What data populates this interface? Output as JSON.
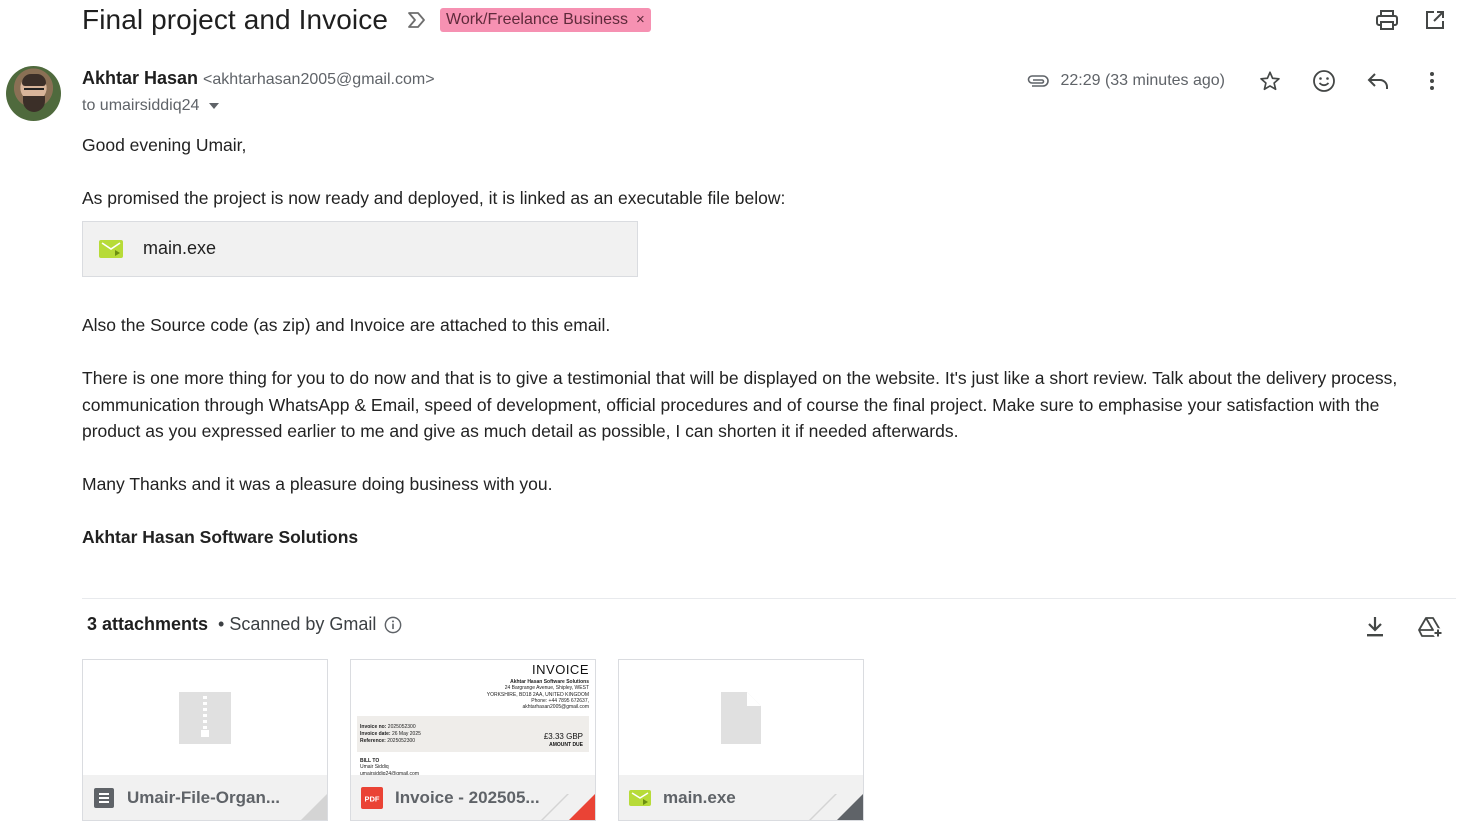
{
  "email": {
    "subject": "Final project and Invoice",
    "label": "Work/Freelance Business",
    "label_color": "#f691b2",
    "sender_name": "Akhtar Hasan",
    "sender_email": "<akhtarhasan2005@gmail.com>",
    "to_line": "to umairsiddiq24",
    "time": "22:29 (33 minutes ago)"
  },
  "icons": {
    "print": "print-icon",
    "open_new_window": "open-in-new-window-icon",
    "star": "star-icon",
    "emoji": "emoji-reaction-icon",
    "reply": "reply-icon",
    "more": "more-vert-icon",
    "attachment": "paperclip-icon",
    "download_all": "download-icon",
    "add_to_drive": "add-to-drive-icon"
  },
  "body": {
    "greeting": "Good evening Umair,",
    "p1": "As promised the project is now ready and deployed, it is linked as an executable file below:",
    "linked_file": "main.exe",
    "p2": "Also the Source code (as zip) and Invoice are attached to this email.",
    "p3": "There is one more thing for you to do now and that is to give a testimonial that will be displayed on the website. It's just like a short review. Talk about the delivery process, communication through WhatsApp & Email, speed of development, official procedures and of course the final project. Make sure to emphasise your satisfaction with the product as you expressed earlier to me and give as much detail as possible, I can shorten it if needed afterwards.",
    "p4": "Many Thanks and it was a pleasure doing business with you.",
    "signature": "Akhtar Hasan Software Solutions"
  },
  "attachments": {
    "count_label": "3 attachments",
    "scanned_label": "• Scanned by Gmail",
    "items": [
      {
        "name": "Umair-File-Organ...",
        "type": "zip"
      },
      {
        "name": "Invoice - 202505...",
        "type": "pdf"
      },
      {
        "name": "main.exe",
        "type": "exe"
      }
    ]
  },
  "invoice_preview": {
    "title": "INVOICE",
    "company": "Akhtar Hasan Software Solutions",
    "address1": "24 Bargrange Avenue, Shipley, WEST",
    "address2": "YORKSHIRE, BD18 2AA, UNITED KINGDOM",
    "phone": "Phone: +44 7895 672637,",
    "email": "akhtarhasan2005@gmail.com",
    "invoice_no_label": "Invoice no:",
    "invoice_no": "2025052300",
    "invoice_date_label": "Invoice date:",
    "invoice_date": "26 May 2025",
    "reference_label": "Reference:",
    "reference": "2025052300",
    "amount": "£3.33 GBP",
    "amount_label": "AMOUNT DUE",
    "bill_to_label": "BILL TO",
    "bill_to_name": "Umair Siddiq",
    "bill_to_email": "umairsiddiq24@gmail.com"
  }
}
